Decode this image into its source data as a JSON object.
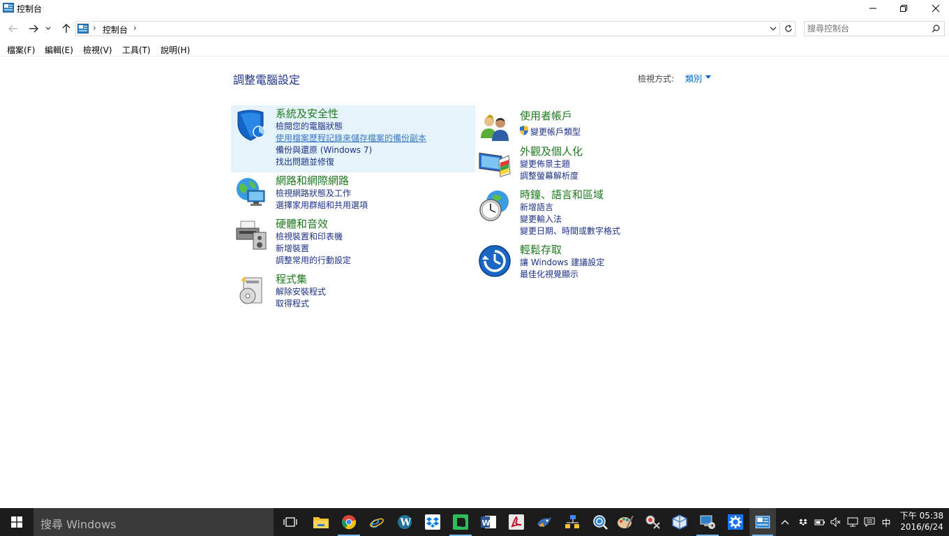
{
  "window": {
    "title": "控制台",
    "minimize": "minimize",
    "maximize": "restore",
    "close": "close"
  },
  "address": {
    "crumb": "控制台",
    "search_placeholder": "搜尋控制台"
  },
  "menu": [
    "檔案(F)",
    "編輯(E)",
    "檢視(V)",
    "工具(T)",
    "說明(H)"
  ],
  "content": {
    "title": "調整電腦設定",
    "view_by_label": "檢視方式:",
    "view_by_value": "類別"
  },
  "categories": [
    {
      "title": "系統及安全性",
      "icon": "shield-icon",
      "links": [
        "檢閱您的電腦狀態",
        "使用檔案歷程記錄來儲存檔案的備份副本",
        "備份與還原 (Windows 7)",
        "找出問題並修復"
      ]
    },
    {
      "title": "網路和網際網路",
      "icon": "network-icon",
      "links": [
        "檢視網路狀態及工作",
        "選擇家用群組和共用選項"
      ]
    },
    {
      "title": "硬體和音效",
      "icon": "printer-icon",
      "links": [
        "檢視裝置和印表機",
        "新增裝置",
        "調整常用的行動設定"
      ]
    },
    {
      "title": "程式集",
      "icon": "programs-icon",
      "links": [
        "解除安裝程式",
        "取得程式"
      ]
    },
    {
      "title": "使用者帳戶",
      "icon": "users-icon",
      "links": [
        "變更帳戶類型"
      ]
    },
    {
      "title": "外觀及個人化",
      "icon": "appearance-icon",
      "links": [
        "變更佈景主題",
        "調整螢幕解析度"
      ]
    },
    {
      "title": "時鐘、語言和區域",
      "icon": "clock-globe-icon",
      "links": [
        "新增語言",
        "變更輸入法",
        "變更日期、時間或數字格式"
      ]
    },
    {
      "title": "輕鬆存取",
      "icon": "ease-of-access-icon",
      "links": [
        "讓 Windows 建議設定",
        "最佳化視覺顯示"
      ]
    }
  ],
  "taskbar": {
    "search_text": "搜尋 Windows",
    "ime": "中",
    "time": "下午 05:38",
    "date": "2016/6/24"
  },
  "colors": {
    "accent": "#1e3287",
    "category_title": "#1f7a1f",
    "hover_bg": "#e5f3fb",
    "taskbar": "#1b1b1b"
  }
}
